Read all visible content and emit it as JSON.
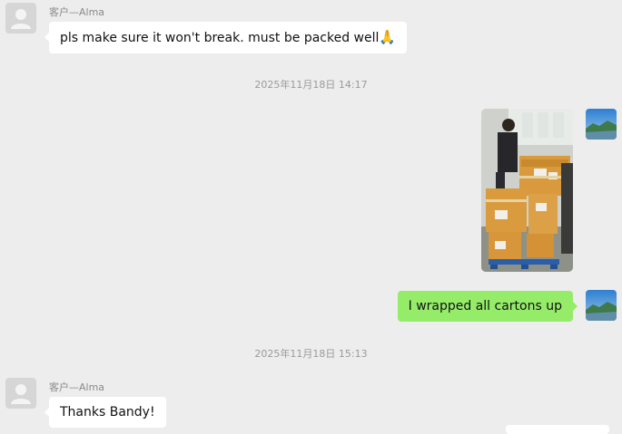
{
  "messages": [
    {
      "type": "text",
      "side": "left",
      "sender": "客户—Alma",
      "text": "pls make sure it won't break. must be packed well",
      "emoji": "🙏",
      "avatar_icon": "default-user-icon"
    },
    {
      "type": "timestamp",
      "text": "2025年11月18日 14:17"
    },
    {
      "type": "image",
      "side": "right",
      "description_icon": "packed-cartons-photo",
      "avatar_icon": "landscape-avatar-icon"
    },
    {
      "type": "text",
      "side": "right",
      "text": "I wrapped all cartons up",
      "avatar_icon": "landscape-avatar-icon"
    },
    {
      "type": "timestamp",
      "text": "2025年11月18日 15:13"
    },
    {
      "type": "text",
      "side": "left",
      "sender": "客户—Alma",
      "text": "Thanks Bandy!",
      "avatar_icon": "default-user-icon"
    }
  ],
  "colors": {
    "background": "#ededed",
    "bubble_incoming": "#ffffff",
    "bubble_outgoing": "#95ec69",
    "name_text": "#8a8a8a",
    "timestamp_text": "#9a9a9a"
  }
}
